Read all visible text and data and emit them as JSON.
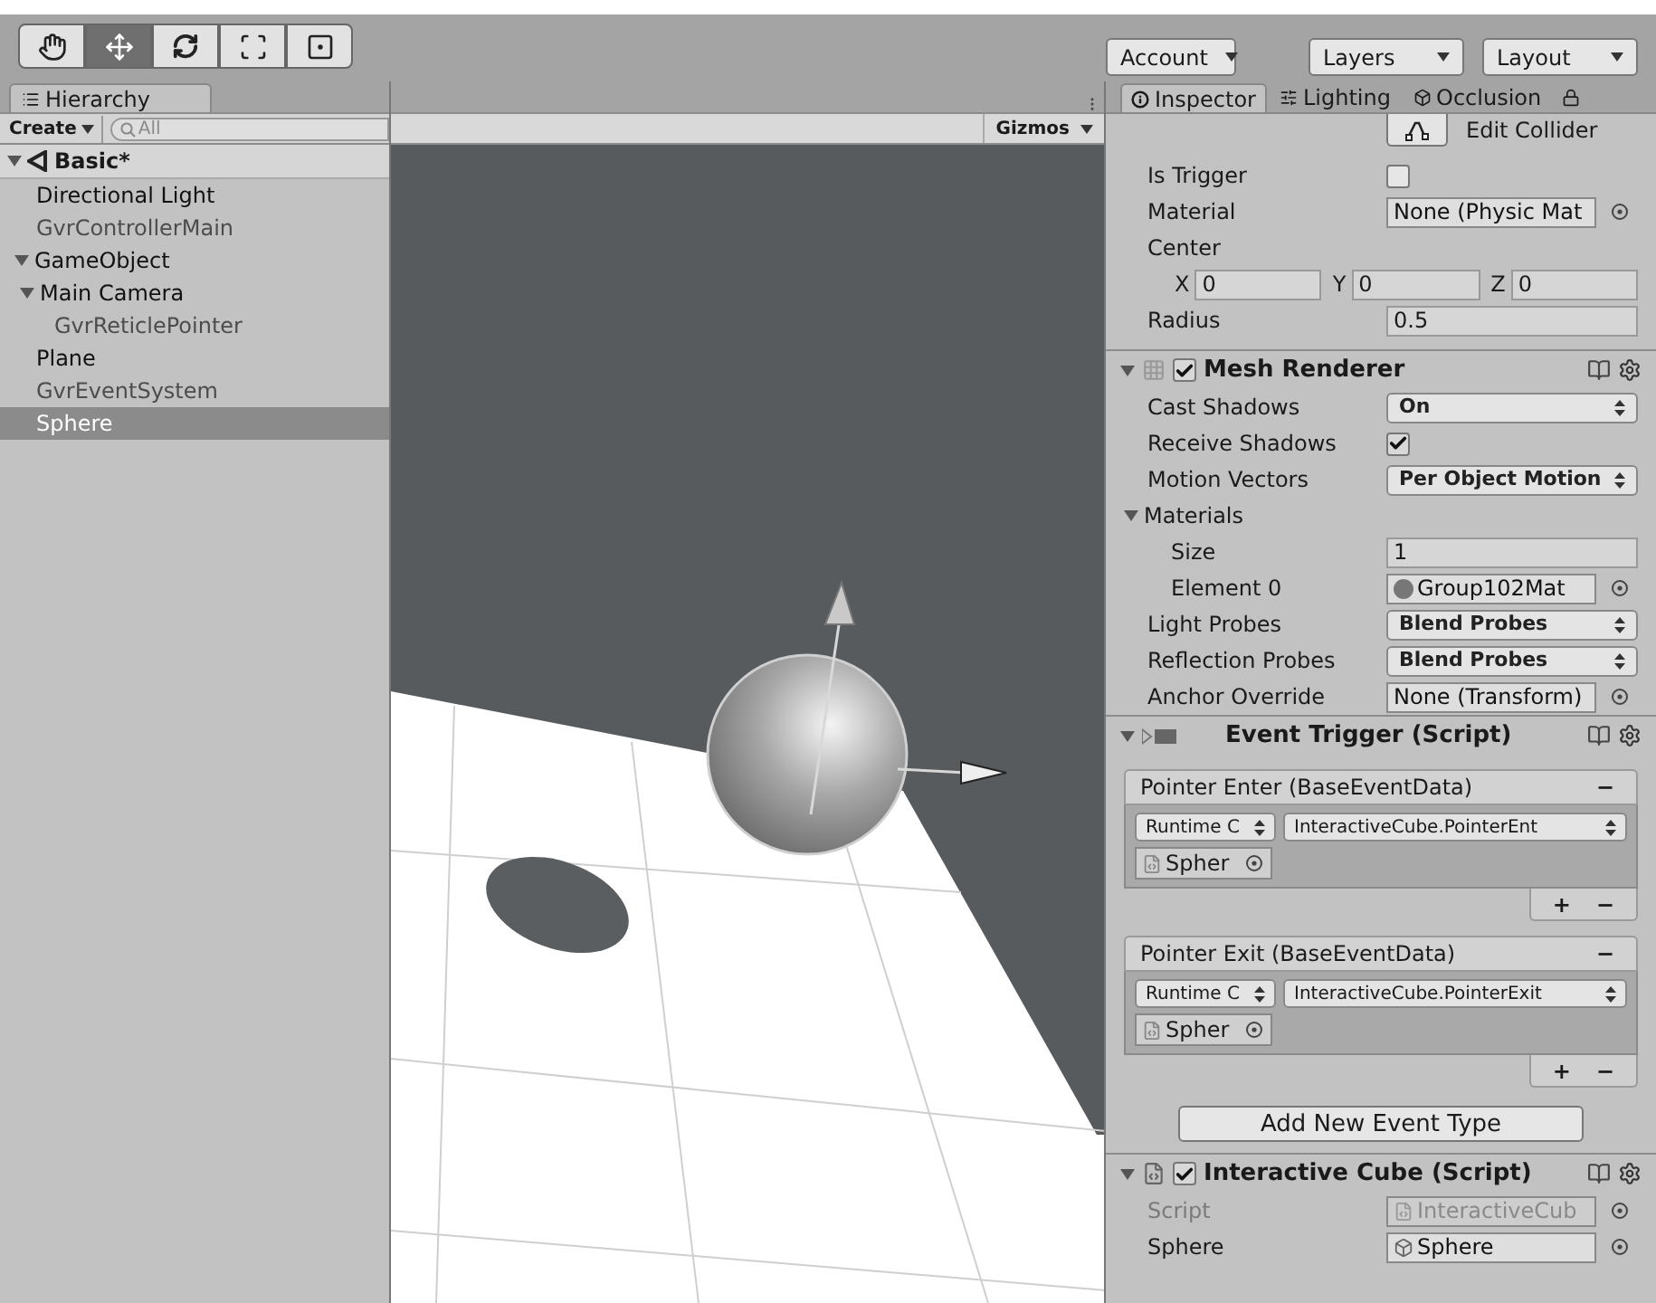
{
  "toolbar": {
    "tools": [
      {
        "kind": "hand",
        "selected": false
      },
      {
        "kind": "move",
        "selected": true
      },
      {
        "kind": "rotate",
        "selected": false
      },
      {
        "kind": "scale",
        "selected": false
      },
      {
        "kind": "rect",
        "selected": false
      }
    ],
    "menus": [
      "Account",
      "Layers",
      "Layout"
    ]
  },
  "hierarchy": {
    "tab": "Hierarchy",
    "create": "Create",
    "search_placeholder": "All",
    "scene": {
      "label": "Basic*",
      "expanded": true,
      "children": [
        {
          "label": "Directional Light",
          "dimmed": false,
          "selected": false
        },
        {
          "label": "GvrControllerMain",
          "dimmed": true,
          "selected": false
        },
        {
          "label": "GameObject",
          "dimmed": false,
          "selected": false,
          "expanded": true,
          "children": [
            {
              "label": "Main Camera",
              "dimmed": false,
              "selected": false,
              "expanded": true,
              "children": [
                {
                  "label": "GvrReticlePointer",
                  "dimmed": true,
                  "selected": false
                }
              ]
            }
          ]
        },
        {
          "label": "Plane",
          "dimmed": false,
          "selected": false
        },
        {
          "label": "GvrEventSystem",
          "dimmed": true,
          "selected": false
        },
        {
          "label": "Sphere",
          "dimmed": false,
          "selected": true
        }
      ]
    }
  },
  "scene_view": {
    "gizmos": "Gizmos"
  },
  "inspector": {
    "tabs": [
      {
        "kind": "info",
        "label": "Inspector",
        "selected": true
      },
      {
        "kind": "lighting",
        "label": "Lighting",
        "selected": false
      },
      {
        "kind": "occlusion",
        "label": "Occlusion",
        "selected": false
      }
    ],
    "collider": {
      "edit_button": "Edit Collider",
      "rows": [
        {
          "kind": "checkbox",
          "label": "Is Trigger",
          "checked": false
        },
        {
          "kind": "object",
          "label": "Material",
          "value": "None (Physic Mat",
          "disabled": false
        },
        {
          "kind": "label",
          "label": "Center"
        },
        {
          "kind": "xyz",
          "fields": [
            {
              "axis": "X",
              "value": "0"
            },
            {
              "axis": "Y",
              "value": "0"
            },
            {
              "axis": "Z",
              "value": "0"
            }
          ]
        },
        {
          "kind": "text",
          "label": "Radius",
          "value": "0.5"
        }
      ]
    },
    "components": [
      {
        "kind": "mesh_renderer",
        "title": "Mesh Renderer",
        "expanded": true,
        "enabled": true,
        "rows": [
          {
            "kind": "dropdown",
            "label": "Cast Shadows",
            "value": "On"
          },
          {
            "kind": "checkbox",
            "label": "Receive Shadows",
            "checked": true
          },
          {
            "kind": "dropdown",
            "label": "Motion Vectors",
            "value": "Per Object Motion"
          },
          {
            "kind": "foldout",
            "label": "Materials",
            "expanded": true,
            "children": [
              {
                "kind": "text",
                "label": "Size",
                "value": "1"
              },
              {
                "kind": "material",
                "label": "Element 0",
                "value": "Group102Mat",
                "disabled": false
              }
            ]
          },
          {
            "kind": "dropdown",
            "label": "Light Probes",
            "value": "Blend Probes"
          },
          {
            "kind": "dropdown",
            "label": "Reflection Probes",
            "value": "Blend Probes"
          },
          {
            "kind": "object",
            "label": "Anchor Override",
            "value": "None (Transform)",
            "disabled": false
          }
        ]
      },
      {
        "kind": "event_trigger",
        "title": "Event Trigger (Script)",
        "expanded": true,
        "entries": [
          {
            "title": "Pointer Enter (BaseEventData)",
            "remove": "−",
            "runtime": "Runtime C",
            "function": "InteractiveCube.PointerEnt",
            "target": "Spher",
            "add": "+",
            "subtract": "−"
          },
          {
            "title": "Pointer Exit (BaseEventData)",
            "remove": "−",
            "runtime": "Runtime C",
            "function": "InteractiveCube.PointerExit",
            "target": "Spher",
            "add": "+",
            "subtract": "−"
          }
        ],
        "add_button": "Add New Event Type"
      },
      {
        "kind": "script",
        "title": "Interactive Cube (Script)",
        "expanded": true,
        "enabled": true,
        "rows": [
          {
            "kind": "script",
            "label": "Script",
            "value": "InteractiveCub",
            "disabled": true
          },
          {
            "kind": "gameobject",
            "label": "Sphere",
            "value": "Sphere",
            "disabled": false
          }
        ]
      }
    ]
  }
}
